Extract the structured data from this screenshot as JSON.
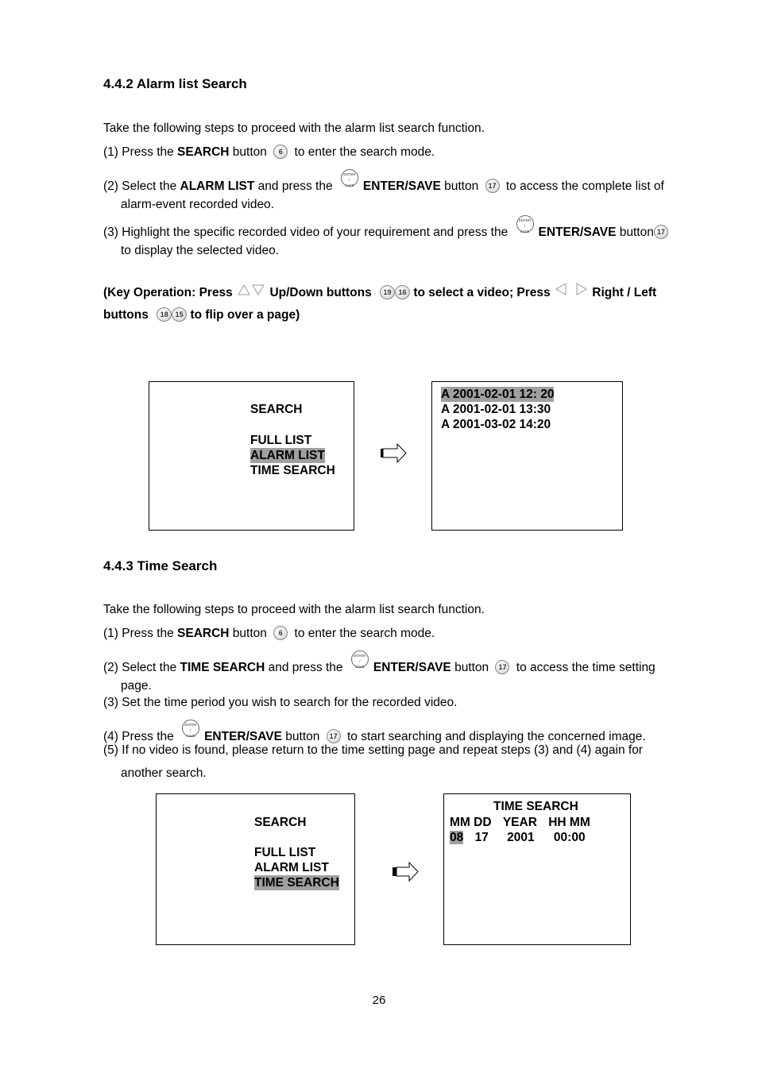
{
  "section_442": {
    "heading": "4.4.2 Alarm list Search",
    "intro": "Take the following steps to proceed with the alarm list search function.",
    "step1": {
      "num": "(1)",
      "pre": "Press the ",
      "bold": "SEARCH",
      "mid": " button",
      "icon": "6",
      "post": " to enter the search mode."
    },
    "step2": {
      "num": "(2)",
      "pre": "Select the ",
      "bold1": "ALARM LIST",
      "mid": " and press the",
      "bold2": "ENTER/SAVE",
      "mid2": " button",
      "icon": "17",
      "post": " to access the complete list of",
      "cont": "alarm-event recorded video."
    },
    "step3": {
      "num": "(3)",
      "pre": "Highlight the specific recorded video of your requirement and press the",
      "bold": "ENTER/SAVE",
      "mid": " button",
      "icon": "17",
      "cont": "to display the selected video."
    },
    "key_op": {
      "part1": "(Key Operation: Press",
      "part2": "Up/Down buttons",
      "icon_up": "19",
      "icon_down": "16",
      "part3": "to select a video; Press",
      "part4": "Right / Left",
      "part5": "buttons",
      "icon_right": "18",
      "icon_left": "15",
      "part6": "to flip over a page)"
    },
    "menu_screen": {
      "title": "SEARCH",
      "items": [
        "FULL LIST",
        "ALARM LIST",
        "TIME SEARCH"
      ],
      "selected_index": 1
    },
    "list_screen": {
      "entries": [
        "A 2001-02-01 12: 20",
        "A 2001-02-01 13:30",
        "A 2001-03-02 14:20"
      ],
      "selected_index": 0
    }
  },
  "section_443": {
    "heading": "4.4.3 Time Search",
    "intro": "Take the following steps to proceed with the alarm list search function.",
    "step1": {
      "num": "(1)",
      "pre": "Press the ",
      "bold": "SEARCH",
      "mid": " button",
      "icon": "6",
      "post": " to enter the search mode."
    },
    "step2": {
      "num": "(2)",
      "pre": "Select the ",
      "bold1": "TIME SEARCH",
      "mid": " and press the",
      "bold2": "ENTER/SAVE",
      "mid2": " button",
      "icon": "17",
      "post": " to access the time setting",
      "cont": "page."
    },
    "step3": {
      "num": "(3)",
      "text": "Set the time period you wish to search for the recorded video."
    },
    "step4": {
      "num": "(4)",
      "pre": "Press the",
      "bold": "ENTER/SAVE",
      "mid": " button",
      "icon": "17",
      "post": " to start searching and displaying the concerned image."
    },
    "step5": {
      "num": "(5)",
      "text": "If no video is found, please return to the time setting page and repeat steps (3) and (4) again for",
      "cont": "another search."
    },
    "menu_screen": {
      "title": "SEARCH",
      "items": [
        "FULL LIST",
        "ALARM LIST",
        "TIME SEARCH"
      ],
      "selected_index": 2
    },
    "time_screen": {
      "title": "TIME SEARCH",
      "header": [
        "MM",
        "DD",
        "YEAR",
        "HH MM"
      ],
      "values": [
        "08",
        "17",
        "2001",
        "00:00"
      ],
      "selected_field": "MM"
    }
  },
  "enter_icon": {
    "top": "ENTER",
    "mid": "/",
    "bottom": "SAVE"
  },
  "page_number": "26",
  "colors": {
    "highlight": "#a0a0a0",
    "text": "#000000"
  }
}
